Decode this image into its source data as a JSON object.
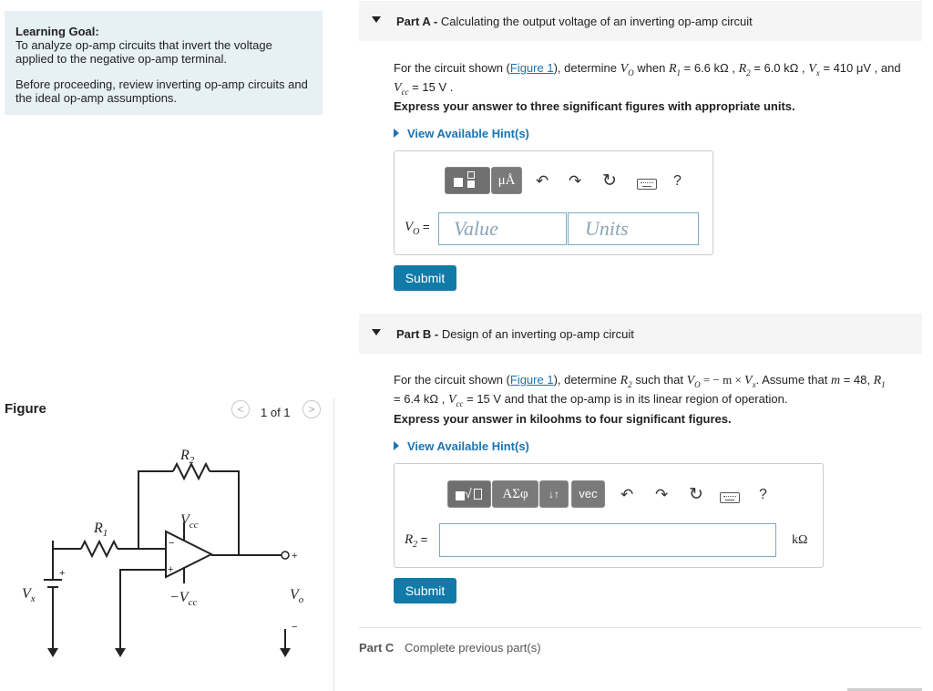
{
  "goal": {
    "heading": "Learning Goal:",
    "text": "To analyze op-amp circuits that invert the voltage applied to the negative op-amp terminal.",
    "note": "Before proceeding, review inverting op-amp circuits and the ideal op-amp assumptions."
  },
  "figure": {
    "title": "Figure",
    "prev_icon": "chevron-left-icon",
    "next_icon": "chevron-right-icon",
    "page_label": "1 of 1",
    "labels": {
      "r2": "R",
      "r2_sub": "2",
      "r1": "R",
      "r1_sub": "1",
      "vcc_top": "V",
      "vcc_top_sub": "cc",
      "vcc_bottom": "−V",
      "vcc_bottom_sub": "cc",
      "vx": "V",
      "vx_sub": "x",
      "vo": "V",
      "vo_sub": "o",
      "minus_in": "−",
      "plus_in": "+",
      "plus_out": "+",
      "minus_out": "−",
      "plus_src": "+"
    }
  },
  "partA": {
    "label_bold": "Part A - ",
    "label": "Calculating the output voltage of an inverting op-amp circuit",
    "q_pre": "For the circuit shown (",
    "q_link": "Figure 1",
    "q_mid": "), determine ",
    "q_vo": "V",
    "q_vo_sub": "O",
    "q_post": " when ",
    "q_r1": "R",
    "q_r1_sub": "1",
    "q_r1_val": " = 6.6 kΩ , ",
    "q_r2": "R",
    "q_r2_sub": "2",
    "q_r2_val": " = 6.0 kΩ , ",
    "q_vx": "V",
    "q_vx_sub": "x",
    "q_vx_val": " = 410 μV , and",
    "q_vcc": "V",
    "q_vcc_sub": "cc",
    "q_vcc_val": " = 15 V .",
    "instruction": "Express your answer to three significant figures with appropriate units.",
    "hint": "View Available Hint(s)",
    "toolbar": {
      "template_icon": "template-icon",
      "units_label": "μÅ",
      "undo_icon": "undo-icon",
      "redo_icon": "redo-icon",
      "reset_icon": "reset-icon",
      "keyboard_icon": "keyboard-icon",
      "help_label": "?"
    },
    "answer_label": "V",
    "answer_label_sub": "O",
    "answer_eq": " =",
    "value_placeholder": "Value",
    "units_placeholder": "Units",
    "submit": "Submit"
  },
  "partB": {
    "label_bold": "Part B - ",
    "label": "Design of an inverting op-amp circuit",
    "q_pre": "For the circuit shown (",
    "q_link": "Figure 1",
    "q_mid": "), determine ",
    "q_r2": "R",
    "q_r2_sub": "2",
    "q_post": " such that ",
    "q_eq": "V",
    "q_eq_sub": "O",
    "q_eq2": " = − m × ",
    "q_vx": "V",
    "q_vx_sub": "x",
    "q_assume": ". Assume that ",
    "q_m": "m",
    "q_m_val": " = 48, ",
    "q_r1": "R",
    "q_r1_sub": "1",
    "q_line2_pre": "= 6.4 kΩ , ",
    "q_vcc": "V",
    "q_vcc_sub": "cc",
    "q_line2_post": " = 15 V and that the op-amp is in its linear region of operation.",
    "instruction": "Express your answer in kiloohms to four significant figures.",
    "hint": "View Available Hint(s)",
    "toolbar": {
      "template_icon": "template-icon",
      "greek_label": "ΑΣφ",
      "sort_label": "↓↑",
      "vec_label": "vec",
      "undo_icon": "undo-icon",
      "redo_icon": "redo-icon",
      "reset_icon": "reset-icon",
      "keyboard_icon": "keyboard-icon",
      "help_label": "?"
    },
    "answer_label": "R",
    "answer_label_sub": "2",
    "answer_eq": " =",
    "unit": "kΩ",
    "submit": "Submit"
  },
  "partC": {
    "label_bold": "Part C",
    "text": "Complete previous part(s)"
  }
}
